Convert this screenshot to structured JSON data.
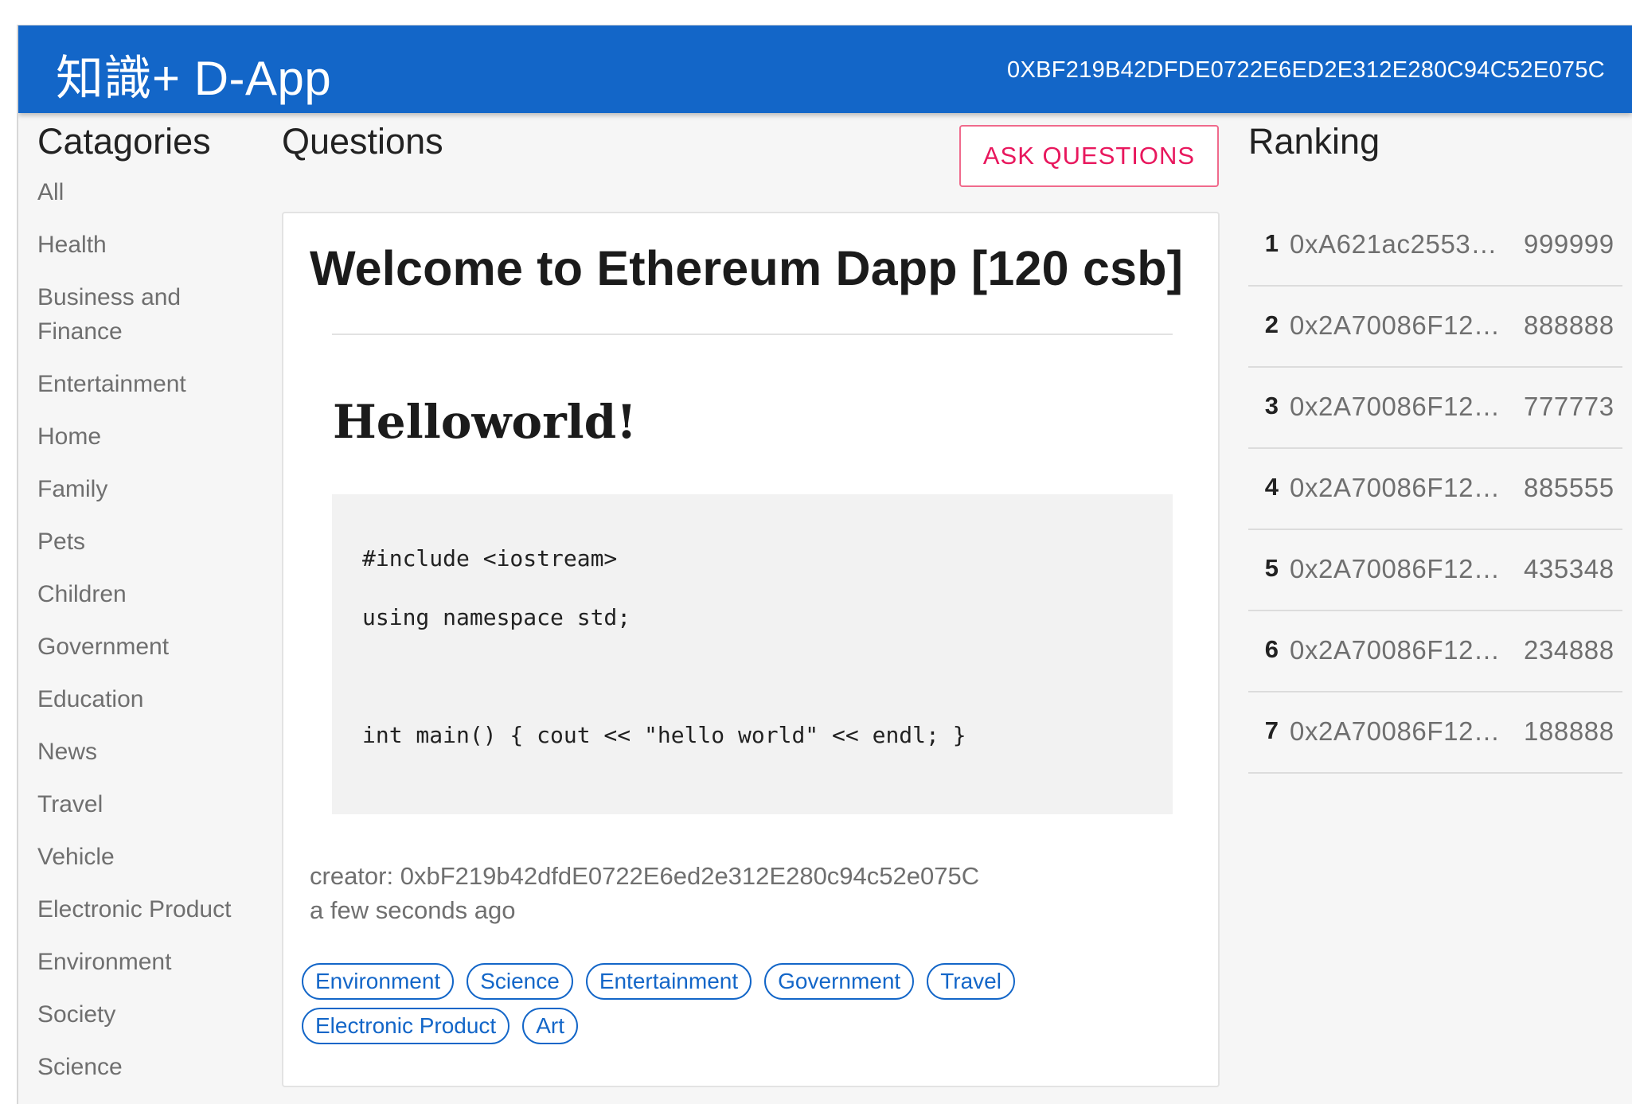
{
  "app": {
    "title": "知識+ D-App",
    "account_address": "0XBF219B42DFDE0722E6ED2E312E280C94C52E075C",
    "brand_color": "#1366c8",
    "accent_color": "#e8175d"
  },
  "categories": {
    "heading": "Catagories",
    "items": [
      {
        "label": "All"
      },
      {
        "label": "Health"
      },
      {
        "label": "Business and Finance"
      },
      {
        "label": "Entertainment"
      },
      {
        "label": "Home"
      },
      {
        "label": "Family"
      },
      {
        "label": "Pets"
      },
      {
        "label": "Children"
      },
      {
        "label": "Government"
      },
      {
        "label": "Education"
      },
      {
        "label": "News"
      },
      {
        "label": "Travel"
      },
      {
        "label": "Vehicle"
      },
      {
        "label": "Electronic Product"
      },
      {
        "label": "Environment"
      },
      {
        "label": "Society"
      },
      {
        "label": "Science"
      }
    ]
  },
  "questions": {
    "heading": "Questions",
    "ask_button_label": "ASK QUESTIONS",
    "card": {
      "title": "Welcome to Ethereum Dapp [120 csb]",
      "body_heading": "Helloworld!",
      "code_lines": [
        "#include <iostream>",
        "using namespace std;",
        "",
        "int main() { cout << \"hello world\" << endl; }"
      ],
      "creator": "creator: 0xbF219b42dfdE0722E6ed2e312E280c94c52e075C",
      "time": "a few seconds ago",
      "tags": [
        {
          "label": "Environment"
        },
        {
          "label": "Science"
        },
        {
          "label": "Entertainment"
        },
        {
          "label": "Government"
        },
        {
          "label": "Travel"
        },
        {
          "label": "Electronic Product"
        },
        {
          "label": "Art"
        }
      ]
    }
  },
  "ranking": {
    "heading": "Ranking",
    "items": [
      {
        "rank": "1",
        "address": "0xA621ac2553…",
        "score": "999999"
      },
      {
        "rank": "2",
        "address": "0x2A70086F12…",
        "score": "888888"
      },
      {
        "rank": "3",
        "address": "0x2A70086F12…",
        "score": "777773"
      },
      {
        "rank": "4",
        "address": "0x2A70086F12…",
        "score": "885555"
      },
      {
        "rank": "5",
        "address": "0x2A70086F12…",
        "score": "435348"
      },
      {
        "rank": "6",
        "address": "0x2A70086F12…",
        "score": "234888"
      },
      {
        "rank": "7",
        "address": "0x2A70086F12…",
        "score": "188888"
      }
    ]
  }
}
